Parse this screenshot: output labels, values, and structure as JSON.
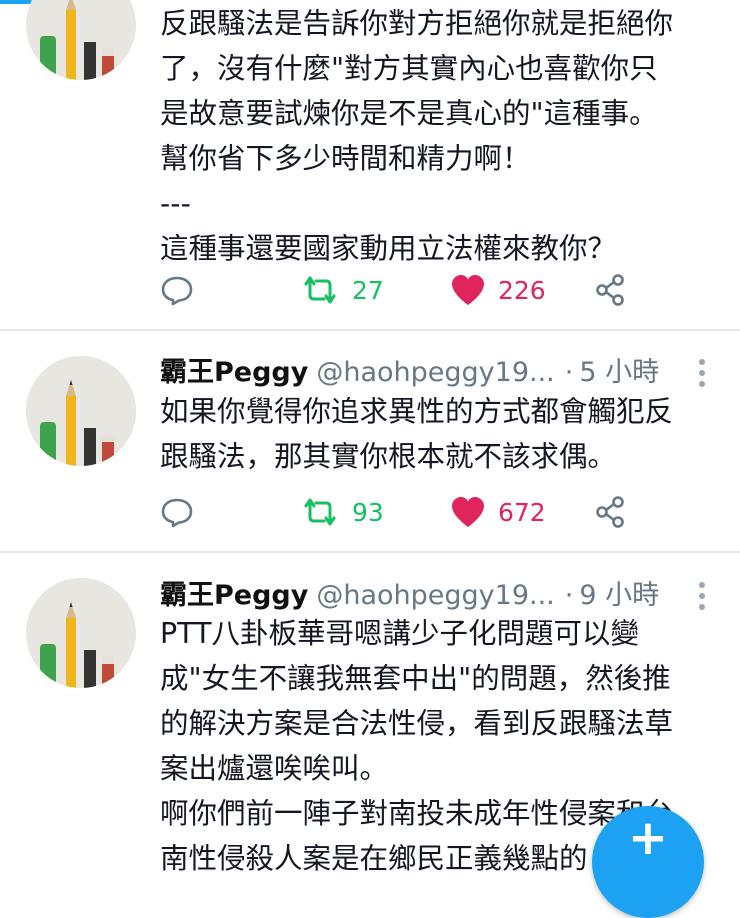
{
  "tweets": [
    {
      "lines": [
        "反跟騷法是告訴你對方拒絕你就是拒絕你",
        "了，沒有什麼\"對方其實內心也喜歡你只",
        "是故意要試煉你是不是真心的\"這種事。",
        "幫你省下多少時間和精力啊！",
        "---",
        "這種事還要國家動用立法權來教你？"
      ],
      "retweets": "27",
      "likes": "226"
    },
    {
      "name": "霸王Peggy",
      "handle": "@haohpeggy19...",
      "dot": "·",
      "time": "5 小時",
      "lines": [
        "如果你覺得你追求異性的方式都會觸犯反",
        "跟騷法，那其實你根本就不該求偶。"
      ],
      "retweets": "93",
      "likes": "672"
    },
    {
      "name": "霸王Peggy",
      "handle": "@haohpeggy19...",
      "dot": "·",
      "time": "9 小時",
      "lines": [
        "PTT八卦板華哥嗯講少子化問題可以變",
        "成\"女生不讓我無套中出\"的問題，然後推",
        "的解決方案是合法性侵，看到反跟騷法草",
        "案出爐還唉唉叫。",
        "啊你們前一陣子對南投未成年性侵案和台",
        "南性侵殺人案是在鄉民正義幾點的"
      ]
    }
  ],
  "fab": {
    "label": "+"
  },
  "icons": {
    "reply": "reply-icon",
    "retweet": "retweet-icon",
    "like": "heart-icon",
    "share": "share-icon",
    "more": "more-vertical-icon",
    "compose": "compose-icon"
  },
  "colors": {
    "accent": "#1da1f2",
    "retweet": "#17bf63",
    "like": "#e0245e",
    "muted": "#687784"
  }
}
